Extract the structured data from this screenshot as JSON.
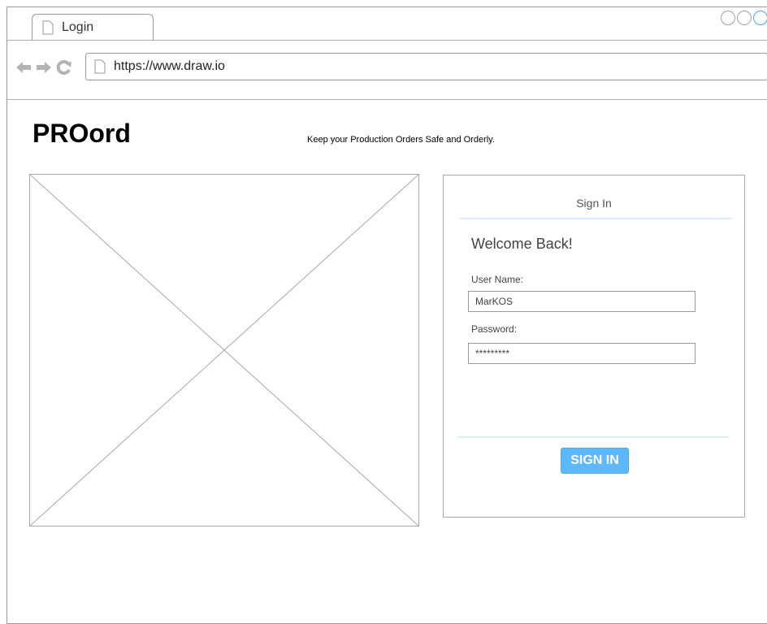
{
  "browser": {
    "tab_label": "Login",
    "url": "https://www.draw.io",
    "icons": [
      "doc-icon",
      "back-arrow-icon",
      "forward-arrow-icon",
      "reload-icon"
    ],
    "window_controls": [
      "minimize-icon",
      "maximize-icon",
      "close-icon"
    ]
  },
  "header": {
    "brand": "PROord",
    "tagline": "Keep your Production Orders Safe and Orderly."
  },
  "login": {
    "title": "Sign In",
    "welcome": "Welcome Back!",
    "username_label": "User Name:",
    "username_value": "MarKOS",
    "password_label": "Password:",
    "password_value": "*********",
    "button_label": "SIGN IN"
  },
  "colors": {
    "accent": "#5cb8ff",
    "divider": "#dbeeff",
    "border": "#9a9a9a"
  }
}
